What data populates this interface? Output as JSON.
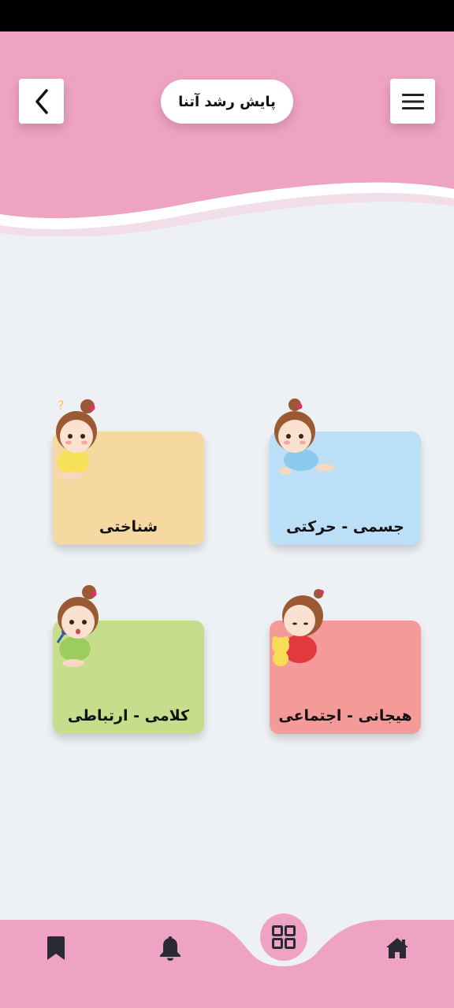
{
  "header": {
    "title": "پایش رشد آتنا"
  },
  "categories": [
    {
      "label": "جسمی - حرکتی",
      "color": "#bcdff8"
    },
    {
      "label": "شناختی",
      "color": "#f5d9a1"
    },
    {
      "label": "هیجانی - اجتماعی",
      "color": "#f49a98"
    },
    {
      "label": "کلامی - ارتباطی",
      "color": "#c6de8c"
    }
  ],
  "icons": {
    "back": "chevron-left-icon",
    "menu": "hamburger-menu-icon",
    "home": "home-icon",
    "grid": "grid-icon",
    "bell": "bell-icon",
    "bookmark": "bookmark-icon"
  },
  "colors": {
    "header_pink": "#efa3c2",
    "background": "#edf1f4",
    "icon_dark": "#2a2a33"
  }
}
